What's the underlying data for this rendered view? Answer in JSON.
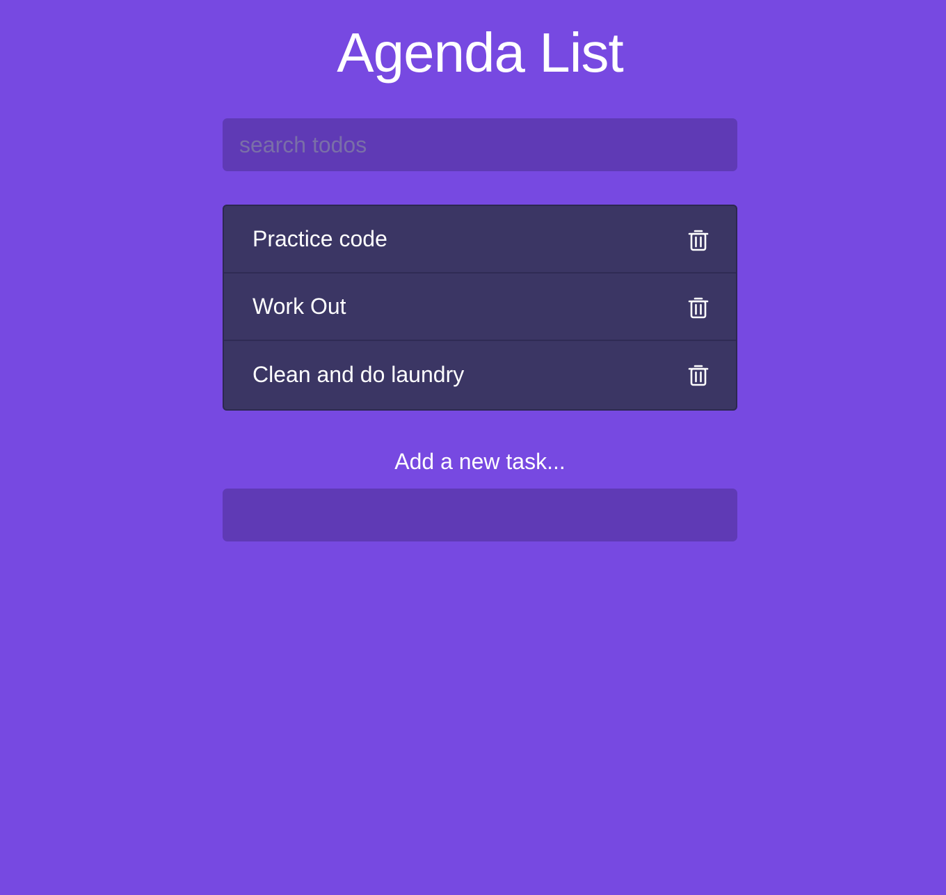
{
  "header": {
    "title": "Agenda List"
  },
  "search": {
    "placeholder": "search todos",
    "value": ""
  },
  "todos": [
    {
      "label": "Practice code",
      "icon": "trash-icon"
    },
    {
      "label": "Work Out",
      "icon": "trash-icon"
    },
    {
      "label": "Clean and do laundry",
      "icon": "trash-icon"
    }
  ],
  "add": {
    "label": "Add a new task...",
    "value": ""
  },
  "colors": {
    "background": "#7749e1",
    "input_background": "#5f3ab5",
    "list_background": "#3b3664",
    "text": "#ffffff"
  }
}
